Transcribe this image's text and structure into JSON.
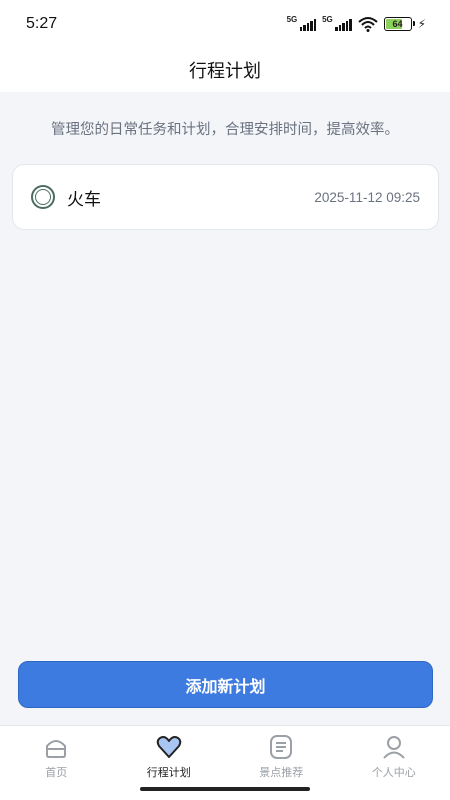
{
  "status_bar": {
    "time": "5:27",
    "signal_1": "5G",
    "signal_2": "5G",
    "battery": "64"
  },
  "nav": {
    "title": "行程计划"
  },
  "subtitle": "管理您的日常任务和计划，合理安排时间，提高效率。",
  "plans": [
    {
      "title": "火车",
      "time": "2025-11-12 09:25"
    }
  ],
  "add_button": "添加新计划",
  "tabs": [
    {
      "label": "首页",
      "icon": "home-icon"
    },
    {
      "label": "行程计划",
      "icon": "heart-icon"
    },
    {
      "label": "景点推荐",
      "icon": "list-icon"
    },
    {
      "label": "个人中心",
      "icon": "user-icon"
    }
  ],
  "colors": {
    "accent": "#3e7be0",
    "background": "#f3f5f8"
  }
}
